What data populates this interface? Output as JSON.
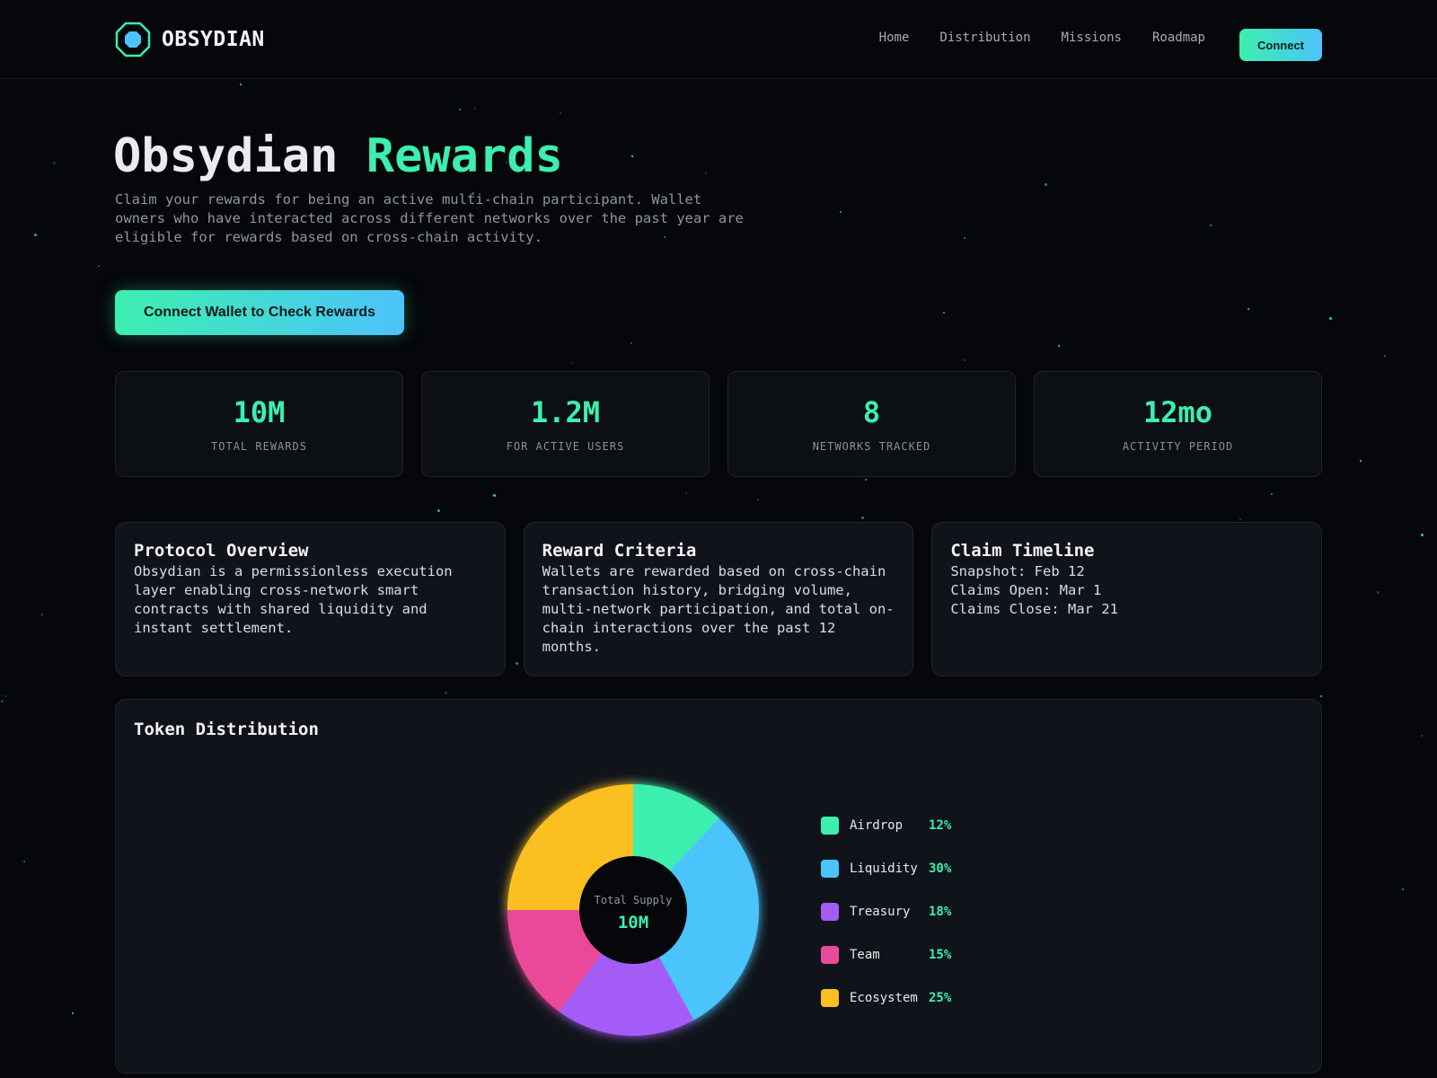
{
  "brand": {
    "name": "OBSYDIAN",
    "logo_icon": "octagon-logo-icon",
    "accent": "#3cefae",
    "accent2": "#4cc3fb"
  },
  "nav": {
    "items": [
      "Home",
      "Distribution",
      "Missions",
      "Roadmap"
    ],
    "connect_label": "Connect"
  },
  "hero": {
    "title_main": "Obsydian ",
    "title_accent": "Rewards",
    "description": "Claim your rewards for being an active multi-chain participant. Wallet owners who have interacted across different networks over the past year are eligible for rewards based on cross-chain activity.",
    "cta_label": "Connect Wallet to Check Rewards"
  },
  "stats": [
    {
      "value": "10M",
      "label": "TOTAL REWARDS"
    },
    {
      "value": "1.2M",
      "label": "FOR ACTIVE USERS"
    },
    {
      "value": "8",
      "label": "NETWORKS TRACKED"
    },
    {
      "value": "12mo",
      "label": "ACTIVITY PERIOD"
    }
  ],
  "cards": {
    "overview": {
      "title": "Protocol Overview",
      "body": "Obsydian is a permissionless execution layer enabling cross-network smart contracts with shared liquidity and instant settlement."
    },
    "criteria": {
      "title": "Reward Criteria",
      "body": "Wallets are rewarded based on cross-chain transaction history, bridging volume, multi-network participation, and total on-chain interactions over the past 12 months."
    },
    "timeline": {
      "title": "Claim Timeline",
      "lines": [
        "Snapshot: Feb 12",
        "Claims Open: Mar 1",
        "Claims Close: Mar 21"
      ]
    }
  },
  "distribution": {
    "title": "Token Distribution",
    "center_label": "Total Supply",
    "center_value": "10M"
  },
  "chart_data": {
    "type": "pie",
    "categories": [
      "Airdrop",
      "Liquidity",
      "Treasury",
      "Team",
      "Ecosystem"
    ],
    "values": [
      12,
      30,
      18,
      15,
      25
    ],
    "labels": [
      "12%",
      "30%",
      "18%",
      "15%",
      "25%"
    ],
    "colors": [
      "#3cefae",
      "#4cc3fb",
      "#a35bf6",
      "#ea4a9a",
      "#fbbf24"
    ],
    "title": "Token Distribution",
    "legend": "right"
  }
}
